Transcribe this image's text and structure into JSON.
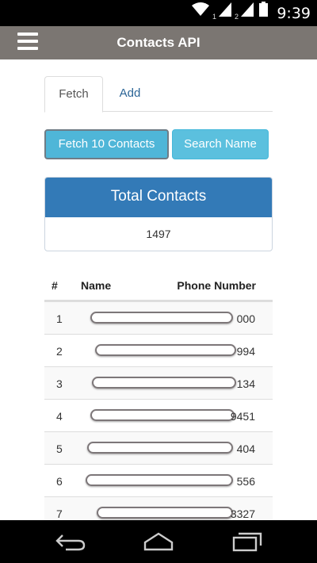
{
  "status_bar": {
    "sim1": "1",
    "sim2": "2",
    "time": "9:39",
    "icons": [
      "wifi-icon",
      "signal-icon",
      "signal-icon",
      "battery-icon"
    ]
  },
  "app_bar": {
    "title": "Contacts API",
    "menu_icon": "hamburger-menu-icon"
  },
  "tabs": [
    {
      "label": "Fetch",
      "active": true
    },
    {
      "label": "Add",
      "active": false
    }
  ],
  "buttons": {
    "fetch": "Fetch 10 Contacts",
    "search": "Search Name"
  },
  "summary": {
    "title": "Total Contacts",
    "value": "1497"
  },
  "table": {
    "headers": [
      "#",
      "Name",
      "Phone Number"
    ],
    "rows": [
      {
        "num": "1",
        "phone": "000"
      },
      {
        "num": "2",
        "phone": "994"
      },
      {
        "num": "3",
        "phone": "134"
      },
      {
        "num": "4",
        "phone": "9451"
      },
      {
        "num": "5",
        "phone": "404"
      },
      {
        "num": "6",
        "phone": "556"
      },
      {
        "num": "7",
        "phone": "3327"
      }
    ]
  },
  "nav_bar": [
    "back-icon",
    "home-icon",
    "recent-apps-icon"
  ],
  "colors": {
    "app_bar": "#7b7672",
    "button_info": "#5bc0de",
    "panel_primary": "#337ab7",
    "link": "#2a6496"
  }
}
